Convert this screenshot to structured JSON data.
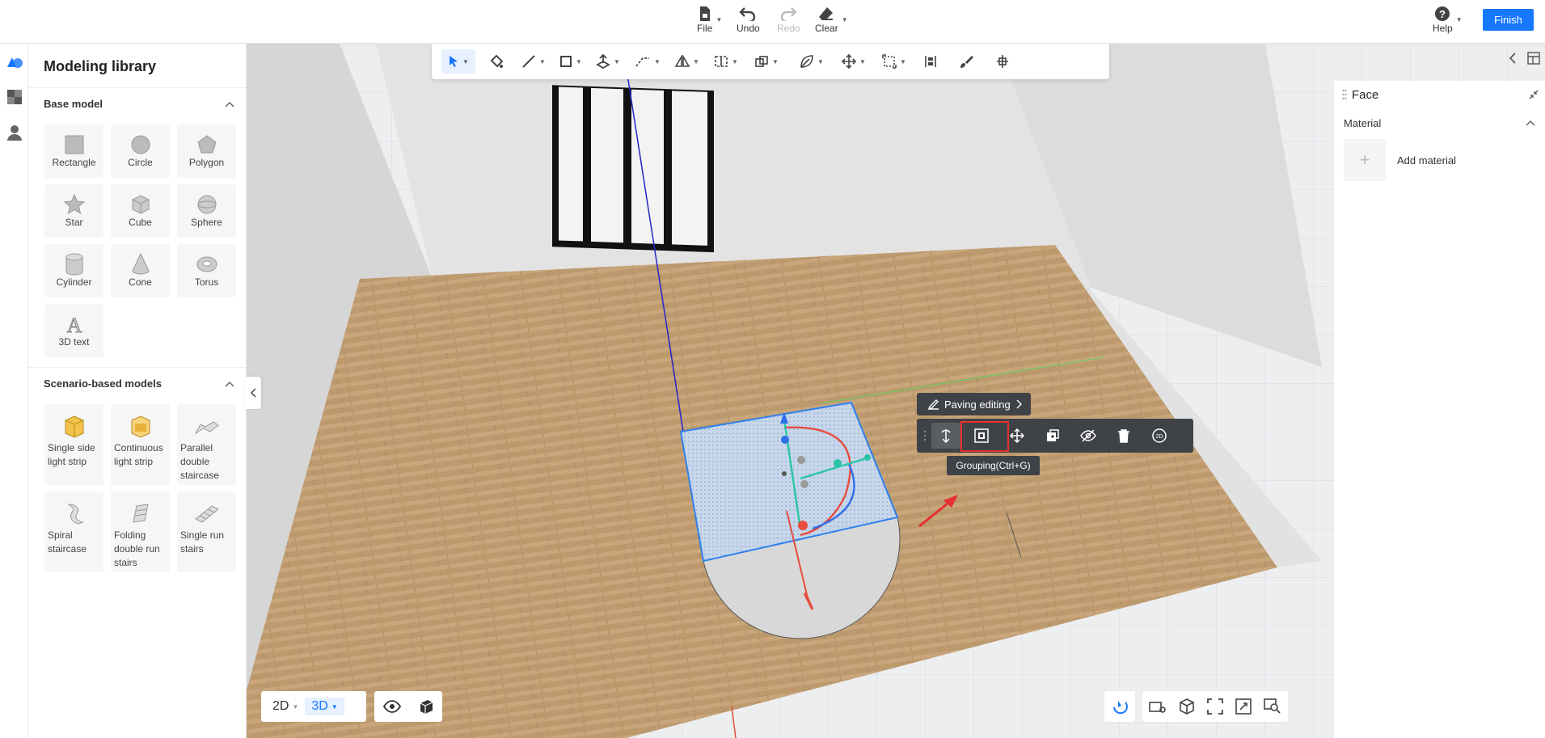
{
  "topbar": {
    "file_label": "File",
    "undo_label": "Undo",
    "redo_label": "Redo",
    "clear_label": "Clear",
    "help_label": "Help",
    "finish_label": "Finish"
  },
  "library": {
    "title": "Modeling library",
    "base_section": "Base model",
    "base_items": [
      "Rectangle",
      "Circle",
      "Polygon",
      "Star",
      "Cube",
      "Sphere",
      "Cylinder",
      "Cone",
      "Torus",
      "3D text"
    ],
    "scenario_section": "Scenario-based models",
    "scenario_items": [
      "Single side light strip",
      "Continuous light strip",
      "Parallel double staircase",
      "Spiral staircase",
      "Folding double run stairs",
      "Single run stairs"
    ]
  },
  "context": {
    "paving_label": "Paving editing",
    "tooltip": "Grouping(Ctrl+G)"
  },
  "view": {
    "mode_2d": "2D",
    "mode_3d": "3D"
  },
  "right_panel": {
    "title": "Face",
    "section": "Material",
    "add_label": "Add material"
  },
  "colors": {
    "accent": "#1677ff",
    "highlight": "#e83030"
  }
}
